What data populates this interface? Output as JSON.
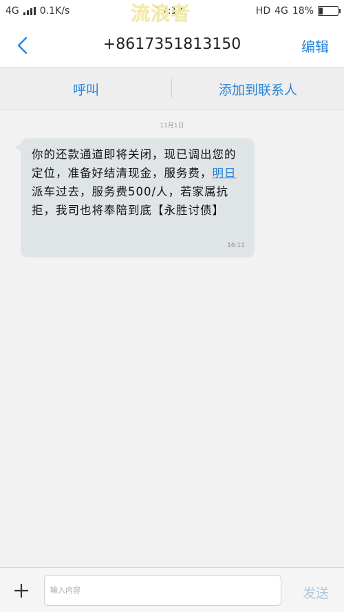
{
  "status_bar": {
    "network_left": "4G",
    "speed": "0.1K/s",
    "time": "17:17",
    "watermark": "流浪者",
    "hd": "HD",
    "network_right": "4G",
    "battery_percent": "18%",
    "battery_level": 0.18
  },
  "header": {
    "title": "+8617351813150",
    "edit_label": "编辑"
  },
  "actions": {
    "call_label": "呼叫",
    "add_contact_label": "添加到联系人"
  },
  "conversation": {
    "date": "11月1日",
    "message": {
      "text_before_link": "你的还款通道即将关闭，现已调出您的定位，准备好结清现金，服务费，",
      "link_text": "明日",
      "text_after_link": "派车过去，服务费500/人，若家属抗拒，我司也将奉陪到底【永胜讨债】",
      "time": "16:11"
    }
  },
  "composer": {
    "placeholder": "输入内容",
    "send_label": "发送"
  },
  "colors": {
    "accent": "#2a84d8",
    "bubble": "#dfe4e6",
    "background": "#f2f2f2"
  }
}
